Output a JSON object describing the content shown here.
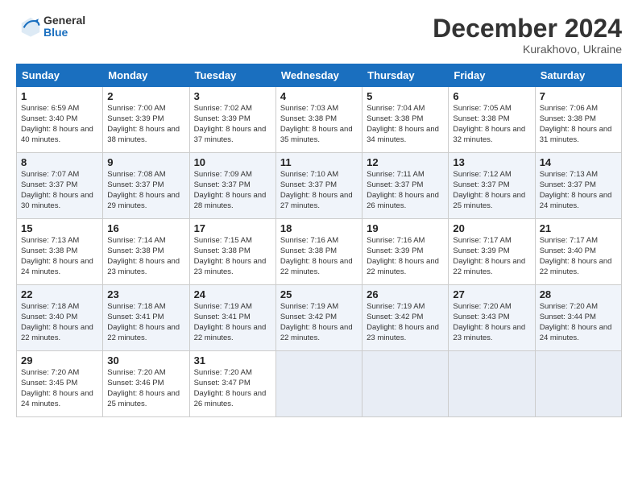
{
  "logo": {
    "general": "General",
    "blue": "Blue"
  },
  "title": "December 2024",
  "location": "Kurakhovo, Ukraine",
  "days_header": [
    "Sunday",
    "Monday",
    "Tuesday",
    "Wednesday",
    "Thursday",
    "Friday",
    "Saturday"
  ],
  "weeks": [
    [
      {
        "day": "1",
        "sunrise": "6:59 AM",
        "sunset": "3:40 PM",
        "daylight": "8 hours and 40 minutes."
      },
      {
        "day": "2",
        "sunrise": "7:00 AM",
        "sunset": "3:39 PM",
        "daylight": "8 hours and 38 minutes."
      },
      {
        "day": "3",
        "sunrise": "7:02 AM",
        "sunset": "3:39 PM",
        "daylight": "8 hours and 37 minutes."
      },
      {
        "day": "4",
        "sunrise": "7:03 AM",
        "sunset": "3:38 PM",
        "daylight": "8 hours and 35 minutes."
      },
      {
        "day": "5",
        "sunrise": "7:04 AM",
        "sunset": "3:38 PM",
        "daylight": "8 hours and 34 minutes."
      },
      {
        "day": "6",
        "sunrise": "7:05 AM",
        "sunset": "3:38 PM",
        "daylight": "8 hours and 32 minutes."
      },
      {
        "day": "7",
        "sunrise": "7:06 AM",
        "sunset": "3:38 PM",
        "daylight": "8 hours and 31 minutes."
      }
    ],
    [
      {
        "day": "8",
        "sunrise": "7:07 AM",
        "sunset": "3:37 PM",
        "daylight": "8 hours and 30 minutes."
      },
      {
        "day": "9",
        "sunrise": "7:08 AM",
        "sunset": "3:37 PM",
        "daylight": "8 hours and 29 minutes."
      },
      {
        "day": "10",
        "sunrise": "7:09 AM",
        "sunset": "3:37 PM",
        "daylight": "8 hours and 28 minutes."
      },
      {
        "day": "11",
        "sunrise": "7:10 AM",
        "sunset": "3:37 PM",
        "daylight": "8 hours and 27 minutes."
      },
      {
        "day": "12",
        "sunrise": "7:11 AM",
        "sunset": "3:37 PM",
        "daylight": "8 hours and 26 minutes."
      },
      {
        "day": "13",
        "sunrise": "7:12 AM",
        "sunset": "3:37 PM",
        "daylight": "8 hours and 25 minutes."
      },
      {
        "day": "14",
        "sunrise": "7:13 AM",
        "sunset": "3:37 PM",
        "daylight": "8 hours and 24 minutes."
      }
    ],
    [
      {
        "day": "15",
        "sunrise": "7:13 AM",
        "sunset": "3:38 PM",
        "daylight": "8 hours and 24 minutes."
      },
      {
        "day": "16",
        "sunrise": "7:14 AM",
        "sunset": "3:38 PM",
        "daylight": "8 hours and 23 minutes."
      },
      {
        "day": "17",
        "sunrise": "7:15 AM",
        "sunset": "3:38 PM",
        "daylight": "8 hours and 23 minutes."
      },
      {
        "day": "18",
        "sunrise": "7:16 AM",
        "sunset": "3:38 PM",
        "daylight": "8 hours and 22 minutes."
      },
      {
        "day": "19",
        "sunrise": "7:16 AM",
        "sunset": "3:39 PM",
        "daylight": "8 hours and 22 minutes."
      },
      {
        "day": "20",
        "sunrise": "7:17 AM",
        "sunset": "3:39 PM",
        "daylight": "8 hours and 22 minutes."
      },
      {
        "day": "21",
        "sunrise": "7:17 AM",
        "sunset": "3:40 PM",
        "daylight": "8 hours and 22 minutes."
      }
    ],
    [
      {
        "day": "22",
        "sunrise": "7:18 AM",
        "sunset": "3:40 PM",
        "daylight": "8 hours and 22 minutes."
      },
      {
        "day": "23",
        "sunrise": "7:18 AM",
        "sunset": "3:41 PM",
        "daylight": "8 hours and 22 minutes."
      },
      {
        "day": "24",
        "sunrise": "7:19 AM",
        "sunset": "3:41 PM",
        "daylight": "8 hours and 22 minutes."
      },
      {
        "day": "25",
        "sunrise": "7:19 AM",
        "sunset": "3:42 PM",
        "daylight": "8 hours and 22 minutes."
      },
      {
        "day": "26",
        "sunrise": "7:19 AM",
        "sunset": "3:42 PM",
        "daylight": "8 hours and 23 minutes."
      },
      {
        "day": "27",
        "sunrise": "7:20 AM",
        "sunset": "3:43 PM",
        "daylight": "8 hours and 23 minutes."
      },
      {
        "day": "28",
        "sunrise": "7:20 AM",
        "sunset": "3:44 PM",
        "daylight": "8 hours and 24 minutes."
      }
    ],
    [
      {
        "day": "29",
        "sunrise": "7:20 AM",
        "sunset": "3:45 PM",
        "daylight": "8 hours and 24 minutes."
      },
      {
        "day": "30",
        "sunrise": "7:20 AM",
        "sunset": "3:46 PM",
        "daylight": "8 hours and 25 minutes."
      },
      {
        "day": "31",
        "sunrise": "7:20 AM",
        "sunset": "3:47 PM",
        "daylight": "8 hours and 26 minutes."
      },
      null,
      null,
      null,
      null
    ]
  ]
}
